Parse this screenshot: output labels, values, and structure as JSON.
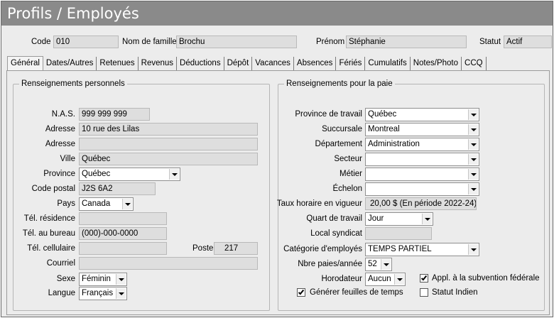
{
  "window": {
    "title": "Profils / Employés"
  },
  "header": {
    "code_label": "Code",
    "code_value": "010",
    "nom_label": "Nom de famille",
    "nom_value": "Brochu",
    "prenom_label": "Prénom",
    "prenom_value": "Stéphanie",
    "statut_label": "Statut",
    "statut_value": "Actif"
  },
  "tabs": [
    "Général",
    "Dates/Autres",
    "Retenues",
    "Revenus",
    "Déductions",
    "Dépôt",
    "Vacances",
    "Absences",
    "Fériés",
    "Cumulatifs",
    "Notes/Photo",
    "CCQ"
  ],
  "personal": {
    "title": "Renseignements personnels",
    "nas_label": "N.A.S.",
    "nas_value": "999 999 999",
    "adresse1_label": "Adresse",
    "adresse1_value": "10 rue des Lilas",
    "adresse2_label": "Adresse",
    "adresse2_value": "",
    "ville_label": "Ville",
    "ville_value": "Québec",
    "province_label": "Province",
    "province_value": "Québec",
    "cp_label": "Code postal",
    "cp_value": "J2S 6A2",
    "pays_label": "Pays",
    "pays_value": "Canada",
    "tel_res_label": "Tél. résidence",
    "tel_res_value": "",
    "tel_bur_label": "Tél. au bureau",
    "tel_bur_value": "(000)-000-0000",
    "tel_cell_label": "Tél. cellulaire",
    "tel_cell_value": "",
    "poste_label": "Poste",
    "poste_value": "217",
    "courriel_label": "Courriel",
    "courriel_value": "",
    "sexe_label": "Sexe",
    "sexe_value": "Féminin",
    "langue_label": "Langue",
    "langue_value": "Français"
  },
  "payroll": {
    "title": "Renseignements pour la paie",
    "province_label": "Province de travail",
    "province_value": "Québec",
    "succursale_label": "Succursale",
    "succursale_value": "Montreal",
    "departement_label": "Département",
    "departement_value": "Administration",
    "secteur_label": "Secteur",
    "secteur_value": "",
    "metier_label": "Métier",
    "metier_value": "",
    "echelon_label": "Échelon",
    "echelon_value": "",
    "taux_label": "Taux horaire en vigueur",
    "taux_value": "20,00 $ (En période 2022-24)",
    "quart_label": "Quart de travail",
    "quart_value": "Jour",
    "local_label": "Local syndicat",
    "local_value": "",
    "categorie_label": "Catégorie d'employés",
    "categorie_value": "TEMPS PARTIEL",
    "nbre_label": "Nbre paies/année",
    "nbre_value": "52",
    "horodateur_label": "Horodateur",
    "horodateur_value": "Aucun",
    "appl_label": "Appl. à la subvention fédérale",
    "appl_checked": true,
    "generer_label": "Générer feuilles de temps",
    "generer_checked": true,
    "statut_indien_label": "Statut Indien",
    "statut_indien_checked": false
  }
}
